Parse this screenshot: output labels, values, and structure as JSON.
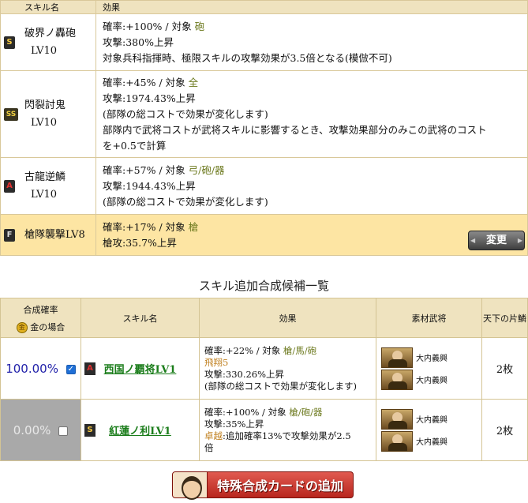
{
  "skill_table": {
    "header_name": "スキル名",
    "header_effect": "効果",
    "rows": [
      {
        "rank": "S",
        "name": "破界ノ轟砲",
        "level": "LV10",
        "line1_prefix": "確率:+100% / 対象",
        "target": "砲",
        "lines": [
          "攻撃:380%上昇",
          "対象兵科指揮時、極限スキルの攻撃効果が3.5倍となる(模倣不可)"
        ]
      },
      {
        "rank": "SS",
        "name": "閃裂討鬼",
        "level": "LV10",
        "line1_prefix": "確率:+45% / 対象",
        "target": "全",
        "lines": [
          "攻撃:1974.43%上昇",
          "(部隊の総コストで効果が変化します)",
          "部隊内で武将コストが武将スキルに影響するとき、攻撃効果部分のみこの武将のコスト",
          "を+0.5で計算"
        ]
      },
      {
        "rank": "A",
        "name": "古龍逆鱗",
        "level": "LV10",
        "line1_prefix": "確率:+57% / 対象",
        "target": "弓/砲/器",
        "lines": [
          "攻撃:1944.43%上昇",
          "(部隊の総コストで効果が変化します)"
        ]
      },
      {
        "rank": "F",
        "name": "槍隊襲撃LV8",
        "level": "",
        "line1_prefix": "確率:+17% / 対象",
        "target": "槍",
        "lines": [
          "槍攻:35.7%上昇"
        ]
      }
    ],
    "change_button": "変更"
  },
  "list_title": "スキル追加合成候補一覧",
  "candidate_table": {
    "headers": {
      "prob_line1": "合成確率",
      "prob_line2": "金の場合",
      "coin": "金",
      "skill_name": "スキル名",
      "effect": "効果",
      "material": "素材武将",
      "tenka": "天下の片鱗"
    },
    "rows": [
      {
        "probability": "100.00%",
        "checked": true,
        "rank": "A",
        "skill": "西国ノ覇将LV1",
        "line1_prefix": "確率:+22% / 対象",
        "target": "槍/馬/砲",
        "special": "飛翔5",
        "lines": [
          "攻撃:330.26%上昇",
          "(部隊の総コストで効果が変化します)"
        ],
        "materials": [
          "大内義興",
          "大内義興"
        ],
        "count": "2枚"
      },
      {
        "probability": "0.00%",
        "checked": false,
        "rank": "S",
        "skill": "紅蓮ノ利LV1",
        "line1_prefix": "確率:+100% / 対象",
        "target": "槍/砲/器",
        "lines2": [
          "攻撃:35%上昇"
        ],
        "special": "卓越",
        "special_text": ":追加確率13%で攻撃効果が2.5",
        "lines3": [
          "倍"
        ],
        "materials": [
          "大内義興",
          "大内義興"
        ],
        "count": "2枚"
      }
    ]
  },
  "add_card_button": "特殊合成カードの追加"
}
